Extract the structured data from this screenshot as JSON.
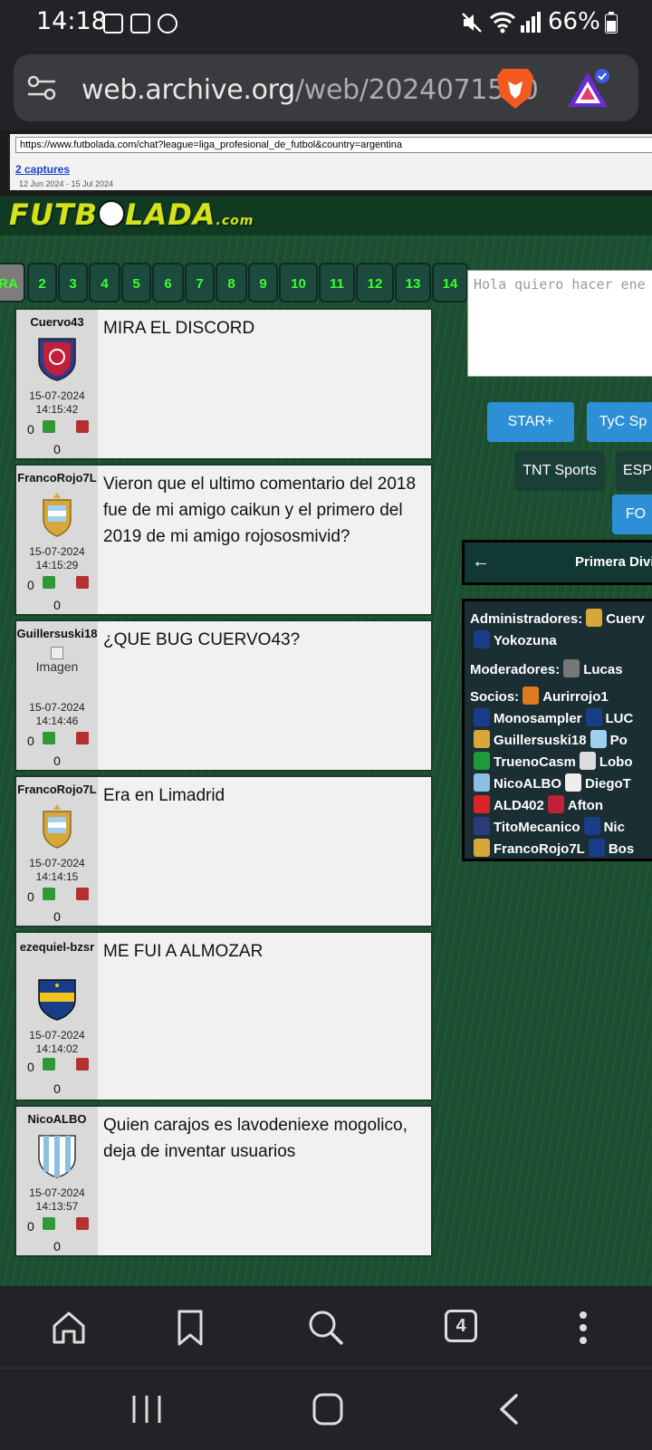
{
  "status_bar": {
    "time": "14:18",
    "battery": "66%"
  },
  "browser": {
    "url_domain": "web.archive.org",
    "url_path": "/web/2024071500"
  },
  "wayback": {
    "url": "https://www.futbolada.com/chat?league=liga_profesional_de_futbol&country=argentina",
    "captures": "2 captures",
    "dates": "12 Jun 2024 - 15 Jul 2024"
  },
  "site": {
    "logo": {
      "left": "FUTB",
      "right": "LADA",
      "suffix": ".com"
    },
    "pages": [
      "RA",
      "2",
      "3",
      "4",
      "5",
      "6",
      "7",
      "8",
      "9",
      "10",
      "11",
      "12",
      "13",
      "14"
    ],
    "messages": [
      {
        "user": "Cuervo43",
        "date": "15-07-2024",
        "time": "14:15:42",
        "likes": "0",
        "score": "0",
        "text": "MIRA EL DISCORD",
        "badge": "#c0203a"
      },
      {
        "user": "FrancoRojo7L",
        "date": "15-07-2024",
        "time": "14:15:29",
        "likes": "0",
        "score": "0",
        "text": "Vieron que el ultimo comentario del 2018 fue de mi amigo caikun y el primero del 2019 de mi amigo rojososmivid?",
        "badge": "#d6a73a"
      },
      {
        "user": "Guillersuski18",
        "date": "15-07-2024",
        "time": "14:14:46",
        "likes": "0",
        "score": "0",
        "text": "¿QUE BUG CUERVO43?",
        "avatar_alt": "Imagen"
      },
      {
        "user": "FrancoRojo7L",
        "date": "15-07-2024",
        "time": "14:14:15",
        "likes": "0",
        "score": "0",
        "text": "Era en Limadrid",
        "badge": "#d6a73a"
      },
      {
        "user": "ezequiel-bzsr",
        "date": "15-07-2024",
        "time": "14:14:02",
        "likes": "0",
        "score": "0",
        "text": "ME FUI A ALMOZAR",
        "badge": "#1a3d8a"
      },
      {
        "user": "NicoALBO",
        "date": "15-07-2024",
        "time": "14:13:57",
        "likes": "0",
        "score": "0",
        "text": "Quien carajos es lavodeniexe mogolico, deja de inventar usuarios",
        "badge": "#8fbfe0"
      }
    ],
    "chat_placeholder": "Hola quiero hacer ene",
    "tv_buttons": {
      "star": "STAR+",
      "tyc": "TyC Sp",
      "tnt": "TNT Sports",
      "esp": "ESP",
      "fo": "FO"
    },
    "league_title": "Primera Divi",
    "roles": {
      "admins_label": "Administradores:",
      "admins": [
        "Cuerv",
        "Yokozuna"
      ],
      "mods_label": "Moderadores:",
      "mods": [
        "Lucas"
      ],
      "socios_label": "Socios:",
      "socios": [
        "Aurirrojo1",
        "Monosampler",
        "LUC",
        "Guillersuski18",
        "Po",
        "TruenoCasm",
        "Lobo",
        "NicoALBO",
        "DiegoT",
        "ALD402",
        "Afton",
        "TitoMecanico",
        "Nic",
        "FrancoRojo7L",
        "Bos"
      ]
    }
  },
  "bottom_nav": {
    "tabs_count": "4"
  }
}
